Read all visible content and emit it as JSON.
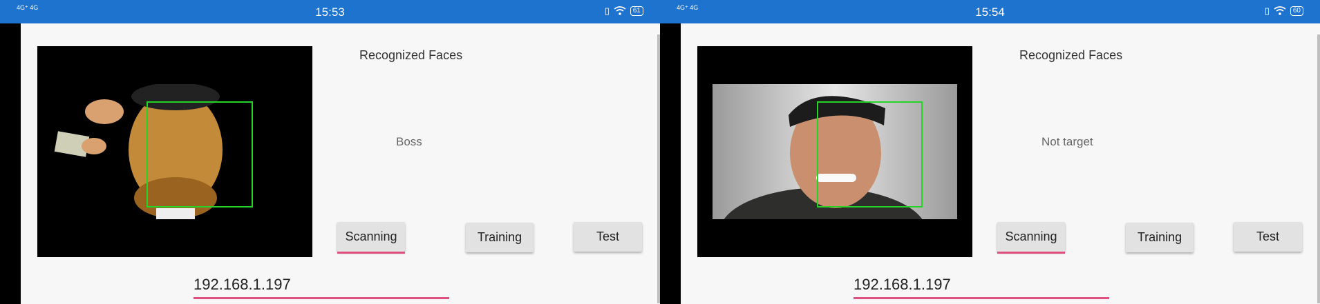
{
  "screens": [
    {
      "status": {
        "network": "4G⁺ 4G",
        "time": "15:53",
        "battery": "61"
      },
      "title": "Recognized Faces",
      "result": "Boss",
      "buttons": {
        "scanning": "Scanning",
        "training": "Training",
        "test": "Test"
      },
      "ip": "192.168.1.197"
    },
    {
      "status": {
        "network": "4G⁺ 4G",
        "time": "15:54",
        "battery": "60"
      },
      "title": "Recognized Faces",
      "result": "Not target",
      "buttons": {
        "scanning": "Scanning",
        "training": "Training",
        "test": "Test"
      },
      "ip": "192.168.1.197"
    }
  ],
  "colors": {
    "statusbar": "#1e73cf",
    "face_box": "#27d327",
    "accent_underline": "#e0507f"
  }
}
